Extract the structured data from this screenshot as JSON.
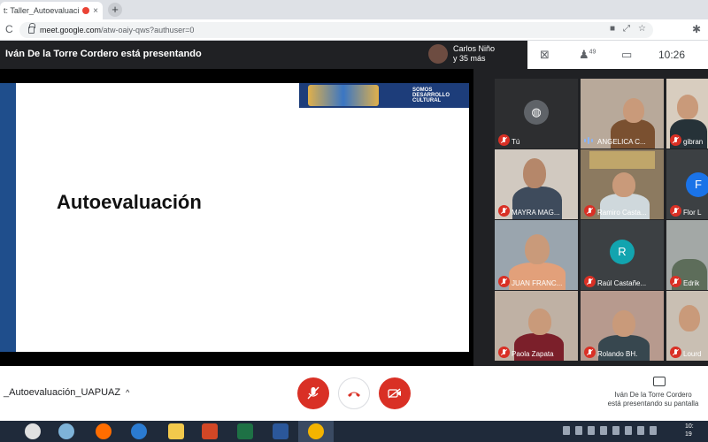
{
  "browser": {
    "tab_title": "t: Taller_Autoevaluación",
    "tab_close": "×",
    "new_tab": "+",
    "url_domain": "meet.google.com",
    "url_path": "/atw-oaiy-qws?authuser=0"
  },
  "meet": {
    "presenter_title": "Iván De la Torre Cordero está presentando",
    "people_chip": {
      "name": "Carlos Niño",
      "more": "y 35 más"
    },
    "participants_count": "49",
    "clock": "10:26",
    "self_corner_label": "Tú"
  },
  "slide": {
    "title": "Autoevaluación",
    "banner_line1": "SOMOS",
    "banner_line2": "DESARROLLO",
    "banner_line3": "CULTURAL"
  },
  "participants": [
    {
      "name": "Tú",
      "type": "avatar-dark"
    },
    {
      "name": "ANGELICA C...",
      "type": "video",
      "speaking": true
    },
    {
      "name": "gibran",
      "type": "video"
    },
    {
      "name": "MAYRA MAG...",
      "type": "video"
    },
    {
      "name": "Ramiro Casta...",
      "type": "video"
    },
    {
      "name": "Flor L",
      "type": "letter",
      "letter": "F",
      "color": "#1a73e8"
    },
    {
      "name": "JUAN FRANC...",
      "type": "video"
    },
    {
      "name": "Raúl Castañe...",
      "type": "letter",
      "letter": "R",
      "color": "#12a4af"
    },
    {
      "name": "Edrik",
      "type": "video"
    },
    {
      "name": "Paola Zapata",
      "type": "video"
    },
    {
      "name": "Rolando BH.",
      "type": "video"
    },
    {
      "name": "Lourd",
      "type": "video"
    }
  ],
  "controls": {
    "meeting_name": "_Autoevaluación_UAPUAZ",
    "chevron": "^",
    "presenting_line1": "Iván De la Torre Cordero",
    "presenting_line2": "está presentando su pantalla"
  },
  "taskbar": {
    "time": "10:",
    "date": "19"
  },
  "colors": {
    "meet_red": "#d93025",
    "meet_dark": "#202124",
    "slide_blue": "#1f4e8c"
  }
}
